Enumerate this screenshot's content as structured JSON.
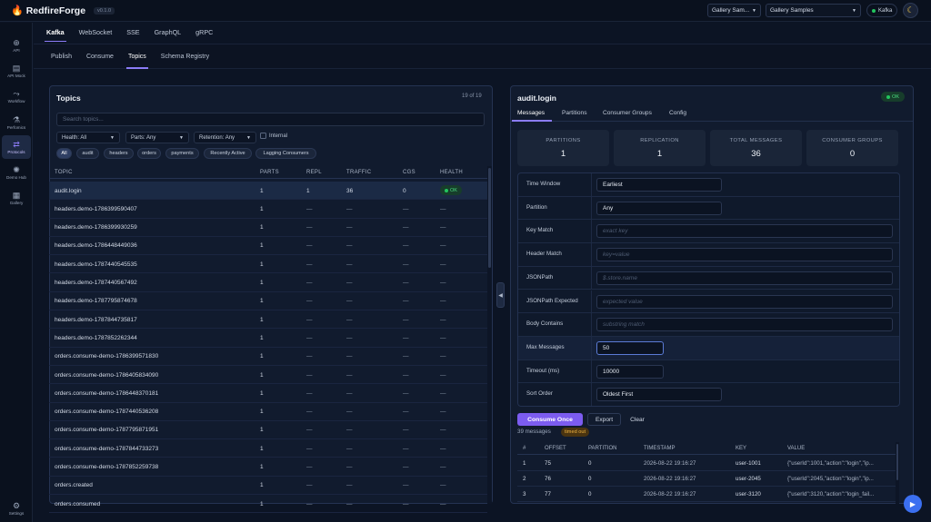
{
  "app": {
    "brand": "RedfireForge",
    "version": "v0.1.0"
  },
  "topbar": {
    "select1": "Gallery Sam...",
    "select2": "Gallery Samples",
    "kafka_status": "Kafka"
  },
  "sidebar": [
    {
      "icon": "globe-icon",
      "glyph": "⊕",
      "label": "API"
    },
    {
      "icon": "mock-icon",
      "glyph": "▤",
      "label": "API Mock"
    },
    {
      "icon": "workflow-icon",
      "glyph": "⤳",
      "label": "Workflow"
    },
    {
      "icon": "flask-icon",
      "glyph": "⚗",
      "label": "Perfomics"
    },
    {
      "icon": "protocols-icon",
      "glyph": "⇄",
      "label": "Protocols",
      "active": true
    },
    {
      "icon": "demo-hub-icon",
      "glyph": "✺",
      "label": "Demo Hub"
    },
    {
      "icon": "gallery-icon",
      "glyph": "▦",
      "label": "Gallery"
    },
    {
      "icon": "settings-icon",
      "glyph": "⚙",
      "label": "Settings"
    }
  ],
  "protocol_tabs": [
    "Kafka",
    "WebSocket",
    "SSE",
    "GraphQL",
    "gRPC"
  ],
  "sub_tabs": [
    "Publish",
    "Consume",
    "Topics",
    "Schema Registry"
  ],
  "topics": {
    "title": "Topics",
    "count": "19 of 19",
    "search_placeholder": "Search topics...",
    "filters": {
      "health": "Health: All",
      "parts": "Parts: Any",
      "retention": "Retention: Any",
      "internal": "Internal"
    },
    "chips": [
      "All",
      "audit",
      "headers",
      "orders",
      "payments",
      "Recently Active",
      "Lagging Consumers"
    ],
    "columns": [
      "TOPIC",
      "PARTS",
      "REPL",
      "TRAFFIC",
      "CGS",
      "HEALTH"
    ],
    "rows": [
      {
        "topic": "audit.login",
        "parts": "1",
        "repl": "1",
        "traffic": "36",
        "cgs": "0",
        "health": "OK"
      },
      {
        "topic": "headers.demo-1786399590407",
        "parts": "1",
        "repl": "—",
        "traffic": "—",
        "cgs": "—",
        "health": "—"
      },
      {
        "topic": "headers.demo-1786399930259",
        "parts": "1",
        "repl": "—",
        "traffic": "—",
        "cgs": "—",
        "health": "—"
      },
      {
        "topic": "headers.demo-1786448449036",
        "parts": "1",
        "repl": "—",
        "traffic": "—",
        "cgs": "—",
        "health": "—"
      },
      {
        "topic": "headers.demo-1787440545535",
        "parts": "1",
        "repl": "—",
        "traffic": "—",
        "cgs": "—",
        "health": "—"
      },
      {
        "topic": "headers.demo-1787440567492",
        "parts": "1",
        "repl": "—",
        "traffic": "—",
        "cgs": "—",
        "health": "—"
      },
      {
        "topic": "headers.demo-1787795874678",
        "parts": "1",
        "repl": "—",
        "traffic": "—",
        "cgs": "—",
        "health": "—"
      },
      {
        "topic": "headers.demo-1787844735817",
        "parts": "1",
        "repl": "—",
        "traffic": "—",
        "cgs": "—",
        "health": "—"
      },
      {
        "topic": "headers.demo-1787852262344",
        "parts": "1",
        "repl": "—",
        "traffic": "—",
        "cgs": "—",
        "health": "—"
      },
      {
        "topic": "orders.consume-demo-1786399571830",
        "parts": "1",
        "repl": "—",
        "traffic": "—",
        "cgs": "—",
        "health": "—"
      },
      {
        "topic": "orders.consume-demo-1786405834090",
        "parts": "1",
        "repl": "—",
        "traffic": "—",
        "cgs": "—",
        "health": "—"
      },
      {
        "topic": "orders.consume-demo-1786448370181",
        "parts": "1",
        "repl": "—",
        "traffic": "—",
        "cgs": "—",
        "health": "—"
      },
      {
        "topic": "orders.consume-demo-1787440536208",
        "parts": "1",
        "repl": "—",
        "traffic": "—",
        "cgs": "—",
        "health": "—"
      },
      {
        "topic": "orders.consume-demo-1787795871951",
        "parts": "1",
        "repl": "—",
        "traffic": "—",
        "cgs": "—",
        "health": "—"
      },
      {
        "topic": "orders.consume-demo-1787844733273",
        "parts": "1",
        "repl": "—",
        "traffic": "—",
        "cgs": "—",
        "health": "—"
      },
      {
        "topic": "orders.consume-demo-1787852259738",
        "parts": "1",
        "repl": "—",
        "traffic": "—",
        "cgs": "—",
        "health": "—"
      },
      {
        "topic": "orders.created",
        "parts": "1",
        "repl": "—",
        "traffic": "—",
        "cgs": "—",
        "health": "—"
      },
      {
        "topic": "orders.consumed",
        "parts": "1",
        "repl": "—",
        "traffic": "—",
        "cgs": "—",
        "health": "—"
      }
    ]
  },
  "detail": {
    "title": "audit.login",
    "status": "OK",
    "tabs": [
      "Messages",
      "Partitions",
      "Consumer Groups",
      "Config"
    ],
    "stats": [
      {
        "label": "PARTITIONS",
        "value": "1"
      },
      {
        "label": "REPLICATION",
        "value": "1"
      },
      {
        "label": "TOTAL MESSAGES",
        "value": "36"
      },
      {
        "label": "CONSUMER GROUPS",
        "value": "0"
      }
    ],
    "form": [
      {
        "label": "Time Window",
        "value": "Earliest",
        "kind": "select"
      },
      {
        "label": "Partition",
        "value": "Any",
        "kind": "select"
      },
      {
        "label": "Key Match",
        "placeholder": "exact key",
        "kind": "input"
      },
      {
        "label": "Header Match",
        "placeholder": "key=value",
        "kind": "input"
      },
      {
        "label": "JSONPath",
        "placeholder": "$.store.name",
        "kind": "input"
      },
      {
        "label": "JSONPath Expected",
        "placeholder": "expected value",
        "kind": "input"
      },
      {
        "label": "Body Contains",
        "placeholder": "substring match",
        "kind": "input"
      },
      {
        "label": "Max Messages",
        "value": "50",
        "kind": "number",
        "focused": true
      },
      {
        "label": "Timeout (ms)",
        "value": "10000",
        "kind": "number"
      },
      {
        "label": "Sort Order",
        "value": "Oldest First",
        "kind": "select"
      }
    ],
    "actions": {
      "consume": "Consume Once",
      "export": "Export",
      "clear": "Clear"
    },
    "messages_count": "39 messages",
    "timeout_badge": "timed out",
    "msg_columns": [
      "#",
      "OFFSET",
      "PARTITION",
      "TIMESTAMP",
      "KEY",
      "VALUE"
    ],
    "messages": [
      {
        "n": "1",
        "offset": "75",
        "partition": "0",
        "timestamp": "2026-08-22 19:16:27",
        "key": "user-1001",
        "value": "{\"userId\":1001,\"action\":\"login\",\"ip..."
      },
      {
        "n": "2",
        "offset": "76",
        "partition": "0",
        "timestamp": "2026-08-22 19:16:27",
        "key": "user-2045",
        "value": "{\"userId\":2045,\"action\":\"login\",\"ip..."
      },
      {
        "n": "3",
        "offset": "77",
        "partition": "0",
        "timestamp": "2026-08-22 19:16:27",
        "key": "user-3120",
        "value": "{\"userId\":3120,\"action\":\"login_fail..."
      }
    ]
  },
  "colors": {
    "accent": "#8b7cf6",
    "primary_button": "#7c5cf0",
    "ok_green": "#4ade80",
    "warn": "#f2b441",
    "background": "#0c1424"
  }
}
